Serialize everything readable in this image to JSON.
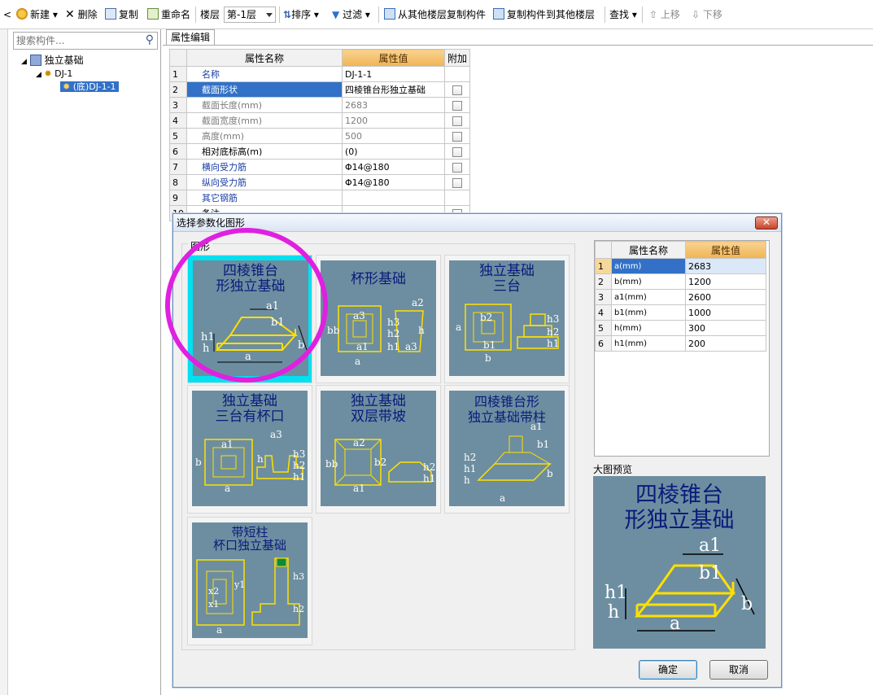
{
  "toolbar": {
    "new_label": "新建",
    "delete_label": "删除",
    "copy_label": "复制",
    "rename_label": "重命名",
    "floor_label": "楼层",
    "floor_value": "第-1层",
    "sort_label": "排序",
    "filter_label": "过滤",
    "copy_from_floor_label": "从其他楼层复制构件",
    "copy_to_floor_label": "复制构件到其他楼层",
    "find_label": "查找",
    "move_up_label": "上移",
    "move_down_label": "下移"
  },
  "tree": {
    "search_placeholder": "搜索构件...",
    "root_label": "独立基础",
    "child_label": "DJ-1",
    "leaf_label": "(底)DJ-1-1"
  },
  "property_panel": {
    "tab_label": "属性编辑",
    "columns": [
      "属性名称",
      "属性值",
      "附加"
    ],
    "rows": [
      {
        "num": "1",
        "name": "名称",
        "value": "DJ-1-1"
      },
      {
        "num": "2",
        "name": "截面形状",
        "value": "四棱锥台形独立基础"
      },
      {
        "num": "3",
        "name": "截面长度(mm)",
        "value": "2683"
      },
      {
        "num": "4",
        "name": "截面宽度(mm)",
        "value": "1200"
      },
      {
        "num": "5",
        "name": "高度(mm)",
        "value": "500"
      },
      {
        "num": "6",
        "name": "相对底标高(m)",
        "value": "(0)"
      },
      {
        "num": "7",
        "name": "横向受力筋",
        "value": "Φ14@180"
      },
      {
        "num": "8",
        "name": "纵向受力筋",
        "value": "Φ14@180"
      },
      {
        "num": "9",
        "name": "其它钢筋",
        "value": ""
      },
      {
        "num": "10",
        "name": "备注",
        "value": ""
      }
    ]
  },
  "dialog": {
    "title": "选择参数化图形",
    "close_label": "✕",
    "shapes_group_label": "图形",
    "shapes": [
      {
        "title": "四棱锥台\n形独立基础"
      },
      {
        "title": "杯形基础"
      },
      {
        "title": "独立基础\n三台"
      },
      {
        "title": "独立基础\n三台有杯口"
      },
      {
        "title": "独立基础\n双层带坡"
      },
      {
        "title": "四棱锥台形\n独立基础带柱"
      },
      {
        "title": "带短柱\n杯口独立基础"
      }
    ],
    "param_columns": [
      "属性名称",
      "属性值"
    ],
    "params": [
      {
        "num": "1",
        "name": "a(mm)",
        "value": "2683"
      },
      {
        "num": "2",
        "name": "b(mm)",
        "value": "1200"
      },
      {
        "num": "3",
        "name": "a1(mm)",
        "value": "2600"
      },
      {
        "num": "4",
        "name": "b1(mm)",
        "value": "1000"
      },
      {
        "num": "5",
        "name": "h(mm)",
        "value": "300"
      },
      {
        "num": "6",
        "name": "h1(mm)",
        "value": "200"
      }
    ],
    "preview_label": "大图预览",
    "preview_title": "四棱锥台\n形独立基础",
    "ok_label": "确定",
    "cancel_label": "取消"
  },
  "colors": {
    "accent_selection": "#3271c7",
    "header_value_bg": "#f0b455",
    "thumbnail_bg": "#6d8ea0",
    "selected_thumb_border": "#00e0f0",
    "highlight_circle": "#e020e0"
  }
}
